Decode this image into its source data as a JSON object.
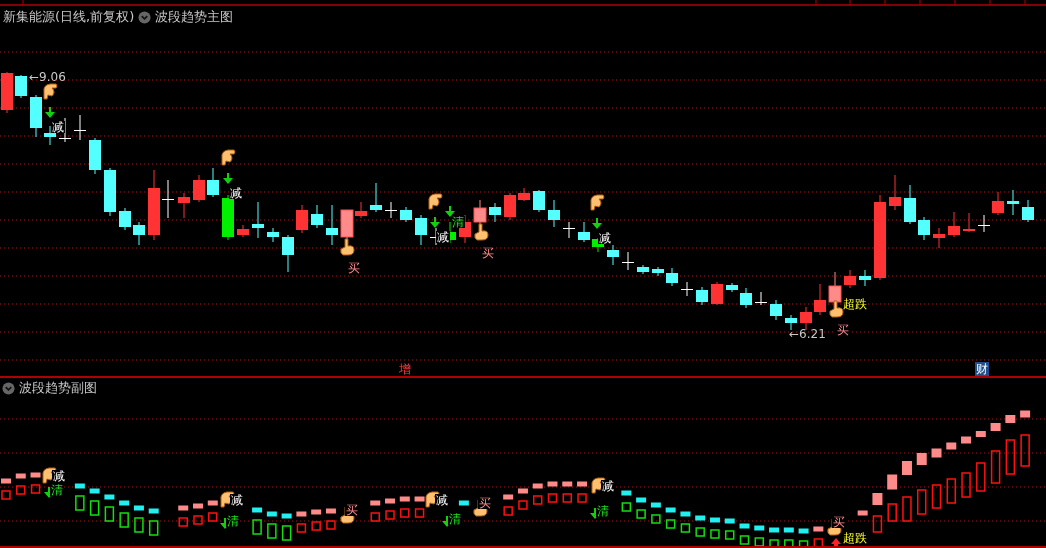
{
  "main_panel": {
    "stock_title": "新集能源(日线,前复权)",
    "indicator": "波段趋势主图",
    "high_label": "←9.06",
    "low_label": "←6.21",
    "signals": [
      {
        "kind": "reduce",
        "text": "减"
      },
      {
        "kind": "reduce",
        "text": "减"
      },
      {
        "kind": "buy",
        "text": "买"
      },
      {
        "kind": "reduce",
        "text": "减"
      },
      {
        "kind": "clear",
        "text": "清"
      },
      {
        "kind": "buy",
        "text": "买"
      },
      {
        "kind": "reduce",
        "text": "减"
      },
      {
        "kind": "oversold",
        "text": "超跌"
      },
      {
        "kind": "buy",
        "text": "买"
      }
    ],
    "events": [
      {
        "kind": "plain",
        "text": "增"
      },
      {
        "kind": "boxed",
        "text": "财"
      }
    ]
  },
  "sub_panel": {
    "indicator": "波段趋势副图",
    "signals": [
      {
        "kind": "reduce",
        "text": "减"
      },
      {
        "kind": "clear",
        "text": "清"
      },
      {
        "kind": "reduce",
        "text": "减"
      },
      {
        "kind": "clear",
        "text": "清"
      },
      {
        "kind": "buy",
        "text": "买"
      },
      {
        "kind": "reduce",
        "text": "减"
      },
      {
        "kind": "clear",
        "text": "清"
      },
      {
        "kind": "buy",
        "text": "买"
      },
      {
        "kind": "reduce",
        "text": "减"
      },
      {
        "kind": "clear",
        "text": "清"
      },
      {
        "kind": "buy",
        "text": "买"
      },
      {
        "kind": "oversold",
        "text": "超跌"
      }
    ]
  }
}
